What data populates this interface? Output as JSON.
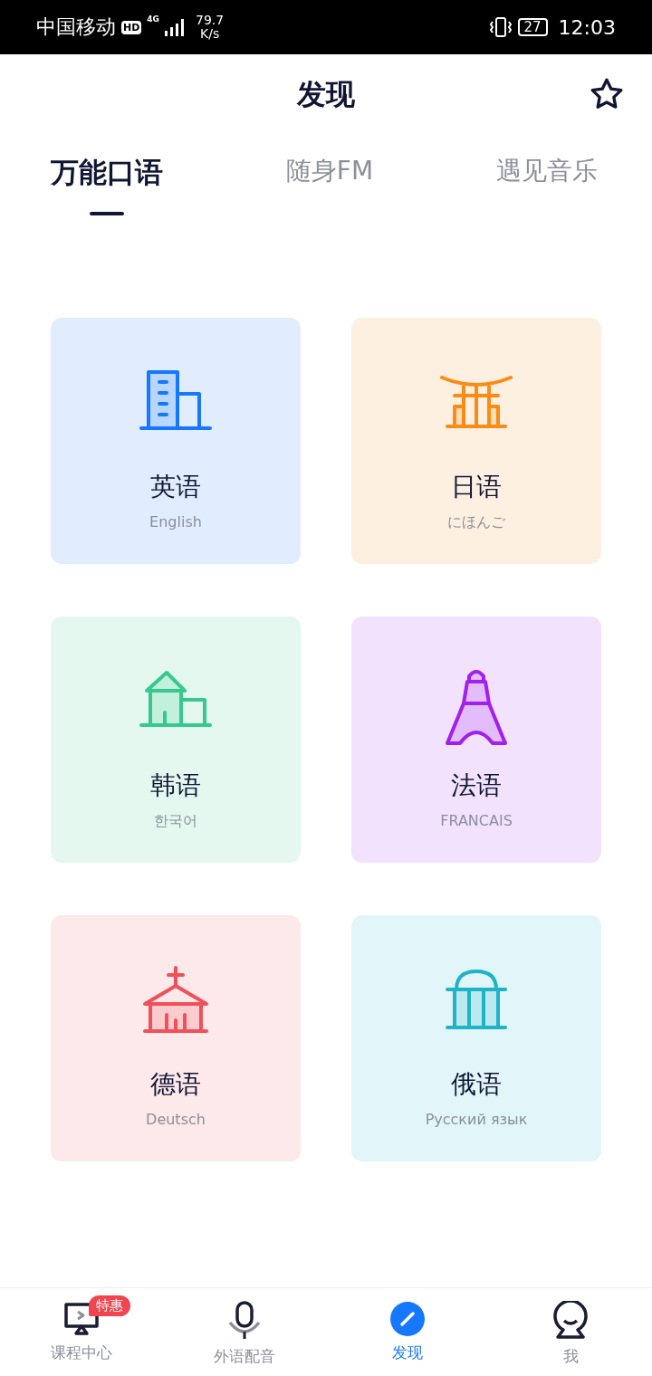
{
  "status_bar": {
    "carrier": "中国移动",
    "hd": "HD",
    "network": "4G",
    "speed_value": "79.7",
    "speed_unit": "K/s",
    "battery": "27",
    "time": "12:03"
  },
  "header": {
    "title": "发现",
    "favorite": false
  },
  "tabs": [
    {
      "label": "万能口语",
      "selected": true
    },
    {
      "label": "随身FM",
      "selected": false
    },
    {
      "label": "遇见音乐",
      "selected": false
    }
  ],
  "languages": [
    {
      "name": "英语",
      "native": "English",
      "kind": "building",
      "color": "#1677ff"
    },
    {
      "name": "日语",
      "native": "にほんご",
      "kind": "gate",
      "color": "#fa8c16"
    },
    {
      "name": "韩语",
      "native": "한국어",
      "kind": "house",
      "color": "#36c98e"
    },
    {
      "name": "法语",
      "native": "FRANCAIS",
      "kind": "tower",
      "color": "#a020f0"
    },
    {
      "name": "德语",
      "native": "Deutsch",
      "kind": "church",
      "color": "#f0505a"
    },
    {
      "name": "俄语",
      "native": "Русский язык",
      "kind": "dome",
      "color": "#1fb3c8"
    }
  ],
  "bottom_nav": [
    {
      "label": "课程中心",
      "kind": "monitor",
      "badge": "特惠",
      "selected": false
    },
    {
      "label": "外语配音",
      "kind": "mic",
      "selected": false
    },
    {
      "label": "发现",
      "kind": "discover",
      "selected": true
    },
    {
      "label": "我",
      "kind": "face",
      "selected": false
    }
  ]
}
